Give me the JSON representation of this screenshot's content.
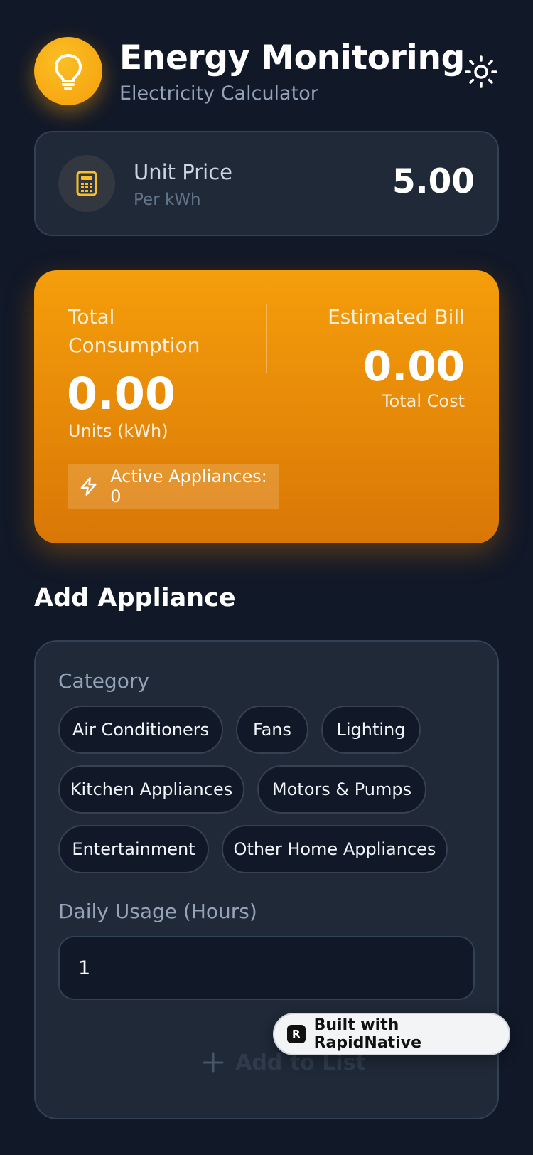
{
  "header": {
    "title": "Energy Monitoring",
    "subtitle": "Electricity Calculator",
    "logo_icon": "lightbulb-icon",
    "theme_icon": "sun-icon"
  },
  "unit_price": {
    "label": "Unit Price",
    "sublabel": "Per kWh",
    "value": "5.00",
    "icon": "calculator-icon"
  },
  "summary": {
    "consumption_label": "Total Consumption",
    "consumption_value": "0.00",
    "consumption_unit": "Units (kWh)",
    "bill_label": "Estimated Bill",
    "bill_value": "0.00",
    "bill_sublabel": "Total Cost",
    "active_label": "Active Appliances: 0",
    "active_icon": "lightning-icon"
  },
  "add_appliance": {
    "title": "Add Appliance",
    "category_label": "Category",
    "categories": [
      "Air Conditioners",
      "Fans",
      "Lighting",
      "Kitchen Appliances",
      "Motors & Pumps",
      "Entertainment",
      "Other Home Appliances"
    ],
    "usage_label": "Daily Usage (Hours)",
    "usage_value": "1",
    "add_button_label": "Add to List",
    "add_icon": "plus-icon"
  },
  "badge": {
    "logo_letter": "R",
    "label": "Built with RapidNative"
  },
  "colors": {
    "background": "#111827",
    "card": "#1f2937",
    "accent": "#f59e0b",
    "accent_dark": "#d97706",
    "muted_text": "#94a3b8"
  }
}
